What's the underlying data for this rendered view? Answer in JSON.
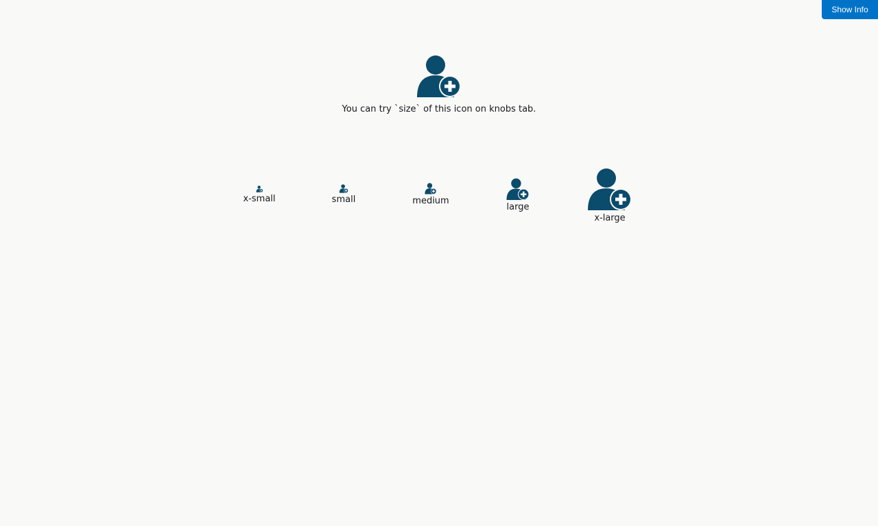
{
  "toolbar": {
    "show_info_label": "Show Info"
  },
  "hero": {
    "icon": "add-user-icon",
    "text": "You can try `size` of this icon on knobs tab."
  },
  "sizes": [
    {
      "label": "x-small",
      "icon": "add-user-icon"
    },
    {
      "label": "small",
      "icon": "add-user-icon"
    },
    {
      "label": "medium",
      "icon": "add-user-icon"
    },
    {
      "label": "large",
      "icon": "add-user-icon"
    },
    {
      "label": "x-large",
      "icon": "add-user-icon"
    }
  ],
  "colors": {
    "icon": "#0b4b6b",
    "accent": "#0073c8",
    "background": "#f9f9f8"
  }
}
